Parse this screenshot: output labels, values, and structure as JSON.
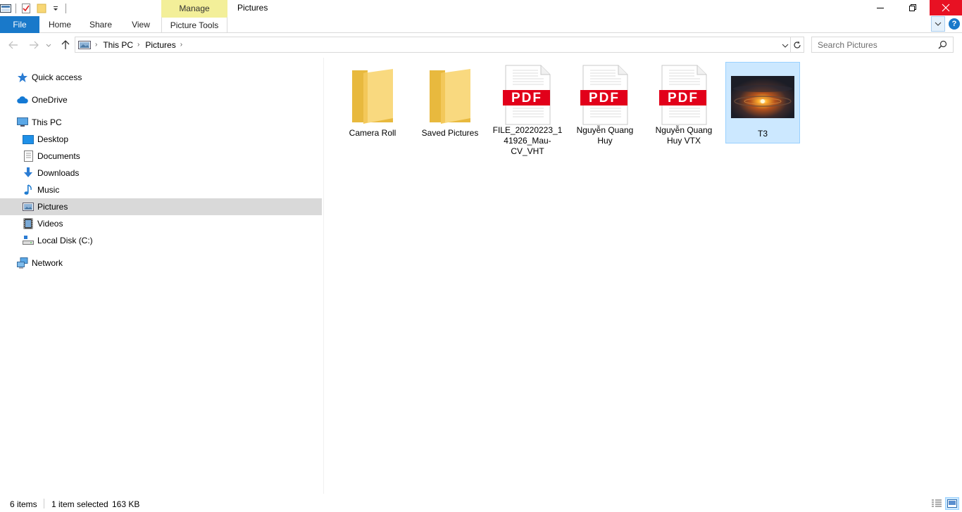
{
  "titlebar": {
    "manage_label": "Manage",
    "window_title": "Pictures"
  },
  "ribbon": {
    "file_label": "File",
    "home_label": "Home",
    "share_label": "Share",
    "view_label": "View",
    "picture_tools_label": "Picture Tools",
    "help_label": "?"
  },
  "address": {
    "crumbs": [
      "This PC",
      "Pictures"
    ]
  },
  "search": {
    "placeholder": "Search Pictures"
  },
  "nav": {
    "items": [
      {
        "label": "Quick access",
        "icon": "star-icon"
      },
      {
        "label": "OneDrive",
        "icon": "cloud-icon"
      },
      {
        "label": "This PC",
        "icon": "computer-icon"
      },
      {
        "label": "Desktop",
        "icon": "desktop-icon"
      },
      {
        "label": "Documents",
        "icon": "document-icon"
      },
      {
        "label": "Downloads",
        "icon": "download-icon"
      },
      {
        "label": "Music",
        "icon": "music-icon"
      },
      {
        "label": "Pictures",
        "icon": "pictures-icon",
        "selected": true
      },
      {
        "label": "Videos",
        "icon": "video-icon"
      },
      {
        "label": "Local Disk (C:)",
        "icon": "disk-icon"
      },
      {
        "label": "Network",
        "icon": "network-icon"
      }
    ]
  },
  "files": [
    {
      "name": "Camera Roll",
      "type": "folder"
    },
    {
      "name": "Saved Pictures",
      "type": "folder"
    },
    {
      "name": "FILE_20220223_141926_Mau-CV_VHT",
      "type": "pdf",
      "badge": "PDF"
    },
    {
      "name": "Nguyễn Quang Huy",
      "type": "pdf",
      "badge": "PDF"
    },
    {
      "name": "Nguyễn Quang Huy VTX",
      "type": "pdf",
      "badge": "PDF"
    },
    {
      "name": "T3",
      "type": "image",
      "selected": true
    }
  ],
  "status": {
    "item_count": "6 items",
    "selection": "1 item selected",
    "size": "163 KB"
  },
  "colors": {
    "accent": "#1979ca",
    "manage_tab": "#f3ef99",
    "close_button": "#e81123",
    "selection": "#cce8ff",
    "pdf_red": "#e2001a",
    "folder": "#f8d775"
  }
}
